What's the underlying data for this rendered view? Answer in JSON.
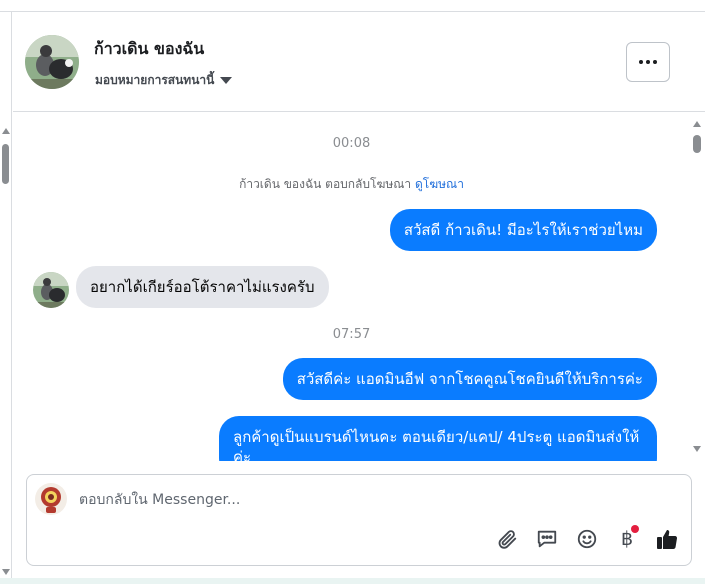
{
  "header": {
    "contact_name": "ก้าวเดิน ของฉัน",
    "assign_label": "มอบหมายการสนทนานี้",
    "more_icon": "more-horizontal-icon"
  },
  "conversation": {
    "timestamp_1": "00:08",
    "ad_reply_text": "ก้าวเดิน ของฉัน ตอบกลับโฆษณา",
    "ad_link": "ดูโฆษณา",
    "messages": [
      {
        "direction": "outgoing",
        "text": "สวัสดี ก้าวเดิน! มีอะไรให้เราช่วยไหม"
      },
      {
        "direction": "incoming",
        "text": "อยากได้เกียร์ออโต้ราคาไม่แรงครับ"
      },
      {
        "direction": "outgoing",
        "text": "สวัสดีค่ะ แอดมินอีฟ จากโชคคูณโชคยินดีให้บริการค่ะ"
      },
      {
        "direction": "outgoing",
        "text": "ลูกค้าดูเป็นแบรนด์ไหนคะ ตอนเดียว/แคป/ 4ประตู แอดมินส่งให้ค่ะ"
      }
    ],
    "timestamp_2": "07:57"
  },
  "composer": {
    "placeholder": "ตอบกลับใน Messenger...",
    "tools": [
      "attachment-icon",
      "saved-reply-icon",
      "emoji-icon",
      "baht-payment-icon",
      "thumbs-up-icon"
    ],
    "baht_symbol": "฿"
  },
  "colors": {
    "outgoing_bubble": "#0a7cff",
    "incoming_bubble": "#e4e6eb",
    "link": "#216fdb",
    "notification_dot": "#e41e3f"
  }
}
